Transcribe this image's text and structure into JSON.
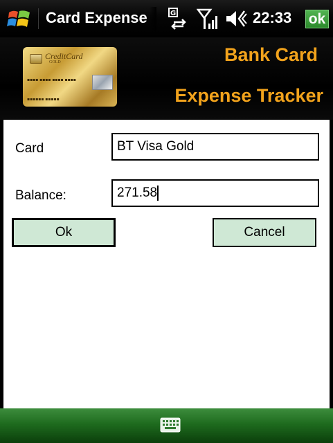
{
  "statusbar": {
    "title": "Card Expense Tracker",
    "time": "22:33",
    "ok_label": "ok"
  },
  "banner": {
    "line1": "Bank Card",
    "line2": "Expense Tracker",
    "card_brand": "CreditCard",
    "card_sub": "GOLD"
  },
  "form": {
    "card_label": "Card",
    "card_value": "BT Visa Gold",
    "balance_label": "Balance:",
    "balance_value": "271.58",
    "ok_button": "Ok",
    "cancel_button": "Cancel"
  },
  "colors": {
    "banner_text": "#f2a31c",
    "button_fill": "#cfe8d5",
    "bottom_bar": "#1e6b1e"
  }
}
